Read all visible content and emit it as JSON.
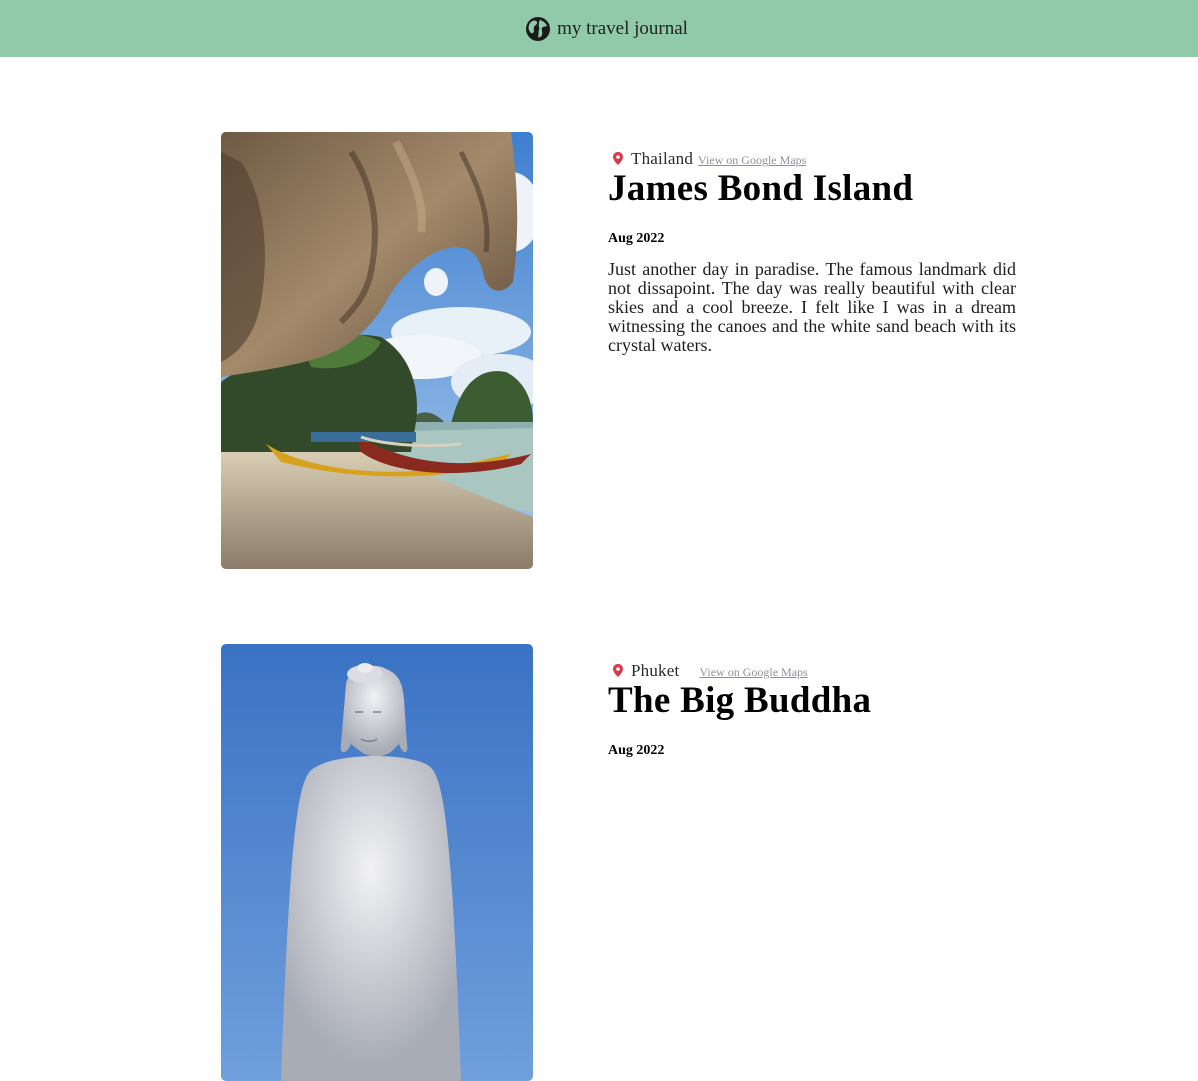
{
  "header": {
    "icon": "globe-icon",
    "title": "my travel journal",
    "background": "#90caa8"
  },
  "entries": [
    {
      "location": "Thailand",
      "maps_link": "View on Google Maps",
      "title": "James Bond Island",
      "date": "Aug 2022",
      "description": "Just another day in paradise. The famous landmark did not dissapoint. The day was really beautiful with clear skies and a cool breeze. I felt like I was in a dream witnessing the canoes and the white sand beach with its crystal waters.",
      "pin_color": "#d63a4a"
    },
    {
      "location": "Phuket",
      "maps_link": "View on Google Maps",
      "title": "The Big Buddha",
      "date": "Aug 2022",
      "pin_color": "#d63a4a"
    }
  ]
}
